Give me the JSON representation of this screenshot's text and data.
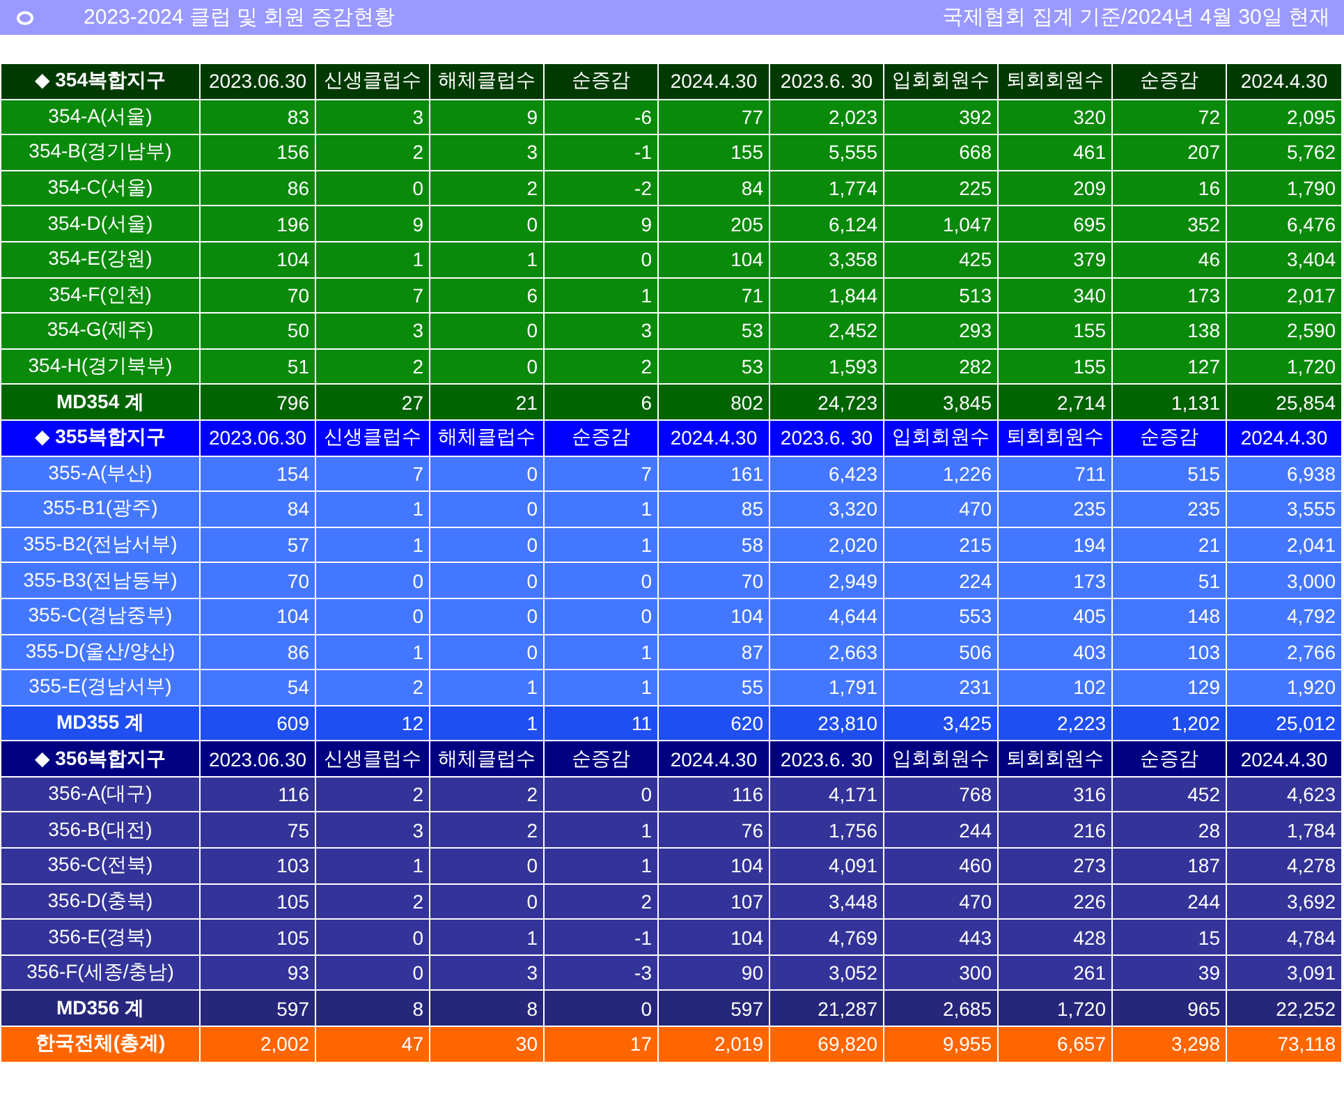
{
  "title": "2023-2024 클럽 및 회원 증감현황",
  "subtitle": "국제협회 집계 기준/2024년 4월 30일 현재",
  "sections": [
    {
      "kind": "green",
      "header": [
        "◆ 354복합지구",
        "2023.06.30",
        "신생클럽수",
        "해체클럽수",
        "순증감",
        "2024.4.30",
        "2023.6. 30",
        "입회회원수",
        "퇴회회원수",
        "순증감",
        "2024.4.30"
      ],
      "rows": [
        {
          "label": "354-A(서울)",
          "values": [
            "83",
            "3",
            "9",
            "-6",
            "77",
            "2,023",
            "392",
            "320",
            "72",
            "2,095"
          ]
        },
        {
          "label": "354-B(경기남부)",
          "values": [
            "156",
            "2",
            "3",
            "-1",
            "155",
            "5,555",
            "668",
            "461",
            "207",
            "5,762"
          ]
        },
        {
          "label": "354-C(서울)",
          "values": [
            "86",
            "0",
            "2",
            "-2",
            "84",
            "1,774",
            "225",
            "209",
            "16",
            "1,790"
          ]
        },
        {
          "label": "354-D(서울)",
          "values": [
            "196",
            "9",
            "0",
            "9",
            "205",
            "6,124",
            "1,047",
            "695",
            "352",
            "6,476"
          ]
        },
        {
          "label": "354-E(강원)",
          "values": [
            "104",
            "1",
            "1",
            "0",
            "104",
            "3,358",
            "425",
            "379",
            "46",
            "3,404"
          ]
        },
        {
          "label": "354-F(인천)",
          "values": [
            "70",
            "7",
            "6",
            "1",
            "71",
            "1,844",
            "513",
            "340",
            "173",
            "2,017"
          ]
        },
        {
          "label": "354-G(제주)",
          "values": [
            "50",
            "3",
            "0",
            "3",
            "53",
            "2,452",
            "293",
            "155",
            "138",
            "2,590"
          ]
        },
        {
          "label": "354-H(경기북부)",
          "values": [
            "51",
            "2",
            "0",
            "2",
            "53",
            "1,593",
            "282",
            "155",
            "127",
            "1,720"
          ]
        }
      ],
      "total": {
        "label": "MD354 계",
        "values": [
          "796",
          "27",
          "21",
          "6",
          "802",
          "24,723",
          "3,845",
          "2,714",
          "1,131",
          "25,854"
        ]
      }
    },
    {
      "kind": "blue",
      "header": [
        "◆ 355복합지구",
        "2023.06.30",
        "신생클럽수",
        "해체클럽수",
        "순증감",
        "2024.4.30",
        "2023.6. 30",
        "입회회원수",
        "퇴회회원수",
        "순증감",
        "2024.4.30"
      ],
      "rows": [
        {
          "label": "355-A(부산)",
          "values": [
            "154",
            "7",
            "0",
            "7",
            "161",
            "6,423",
            "1,226",
            "711",
            "515",
            "6,938"
          ]
        },
        {
          "label": "355-B1(광주)",
          "values": [
            "84",
            "1",
            "0",
            "1",
            "85",
            "3,320",
            "470",
            "235",
            "235",
            "3,555"
          ]
        },
        {
          "label": "355-B2(전남서부)",
          "values": [
            "57",
            "1",
            "0",
            "1",
            "58",
            "2,020",
            "215",
            "194",
            "21",
            "2,041"
          ]
        },
        {
          "label": "355-B3(전남동부)",
          "values": [
            "70",
            "0",
            "0",
            "0",
            "70",
            "2,949",
            "224",
            "173",
            "51",
            "3,000"
          ]
        },
        {
          "label": "355-C(경남중부)",
          "values": [
            "104",
            "0",
            "0",
            "0",
            "104",
            "4,644",
            "553",
            "405",
            "148",
            "4,792"
          ]
        },
        {
          "label": "355-D(울산/양산)",
          "values": [
            "86",
            "1",
            "0",
            "1",
            "87",
            "2,663",
            "506",
            "403",
            "103",
            "2,766"
          ]
        },
        {
          "label": "355-E(경남서부)",
          "values": [
            "54",
            "2",
            "1",
            "1",
            "55",
            "1,791",
            "231",
            "102",
            "129",
            "1,920"
          ]
        }
      ],
      "total": {
        "label": "MD355 계",
        "values": [
          "609",
          "12",
          "1",
          "11",
          "620",
          "23,810",
          "3,425",
          "2,223",
          "1,202",
          "25,012"
        ]
      }
    },
    {
      "kind": "navy",
      "header": [
        "◆ 356복합지구",
        "2023.06.30",
        "신생클럽수",
        "해체클럽수",
        "순증감",
        "2024.4.30",
        "2023.6. 30",
        "입회회원수",
        "퇴회회원수",
        "순증감",
        "2024.4.30"
      ],
      "rows": [
        {
          "label": "356-A(대구)",
          "values": [
            "116",
            "2",
            "2",
            "0",
            "116",
            "4,171",
            "768",
            "316",
            "452",
            "4,623"
          ]
        },
        {
          "label": "356-B(대전)",
          "values": [
            "75",
            "3",
            "2",
            "1",
            "76",
            "1,756",
            "244",
            "216",
            "28",
            "1,784"
          ]
        },
        {
          "label": "356-C(전북)",
          "values": [
            "103",
            "1",
            "0",
            "1",
            "104",
            "4,091",
            "460",
            "273",
            "187",
            "4,278"
          ]
        },
        {
          "label": "356-D(충북)",
          "values": [
            "105",
            "2",
            "0",
            "2",
            "107",
            "3,448",
            "470",
            "226",
            "244",
            "3,692"
          ]
        },
        {
          "label": "356-E(경북)",
          "values": [
            "105",
            "0",
            "1",
            "-1",
            "104",
            "4,769",
            "443",
            "428",
            "15",
            "4,784"
          ]
        },
        {
          "label": "356-F(세종/충남)",
          "values": [
            "93",
            "0",
            "3",
            "-3",
            "90",
            "3,052",
            "300",
            "261",
            "39",
            "3,091"
          ]
        }
      ],
      "total": {
        "label": "MD356 계",
        "values": [
          "597",
          "8",
          "8",
          "0",
          "597",
          "21,287",
          "2,685",
          "1,720",
          "965",
          "22,252"
        ]
      }
    }
  ],
  "grand_total": {
    "label": "한국전체(총계)",
    "values": [
      "2,002",
      "47",
      "30",
      "17",
      "2,019",
      "69,820",
      "9,955",
      "6,657",
      "3,298",
      "73,118"
    ]
  }
}
